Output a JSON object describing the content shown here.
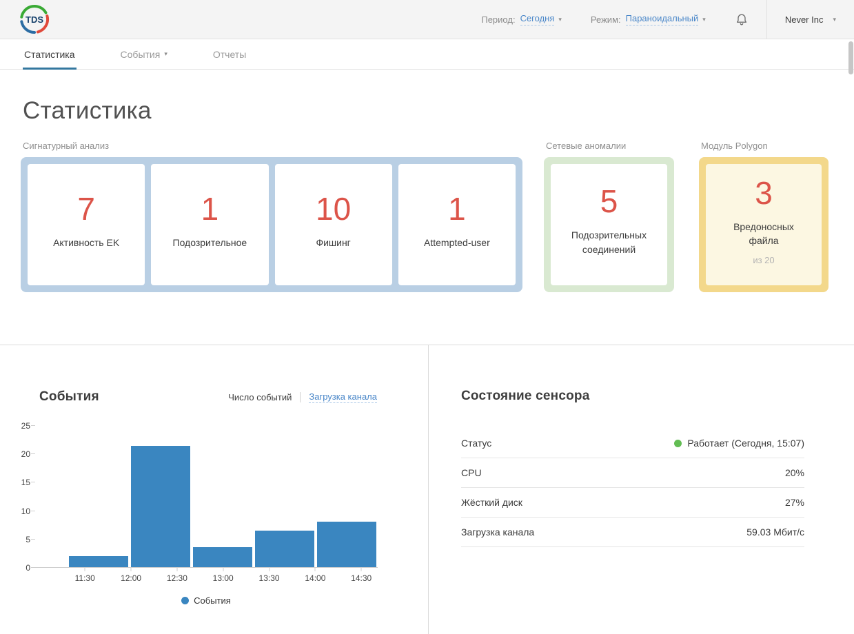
{
  "header": {
    "logo_text": "TDS",
    "period_label": "Период:",
    "period_value": "Сегодня",
    "mode_label": "Режим:",
    "mode_value": "Параноидальный",
    "account_name": "Never Inc"
  },
  "tabs": [
    {
      "label": "Статистика",
      "active": true
    },
    {
      "label": "События",
      "has_dropdown": true
    },
    {
      "label": "Отчеты",
      "active": false
    }
  ],
  "page": {
    "title": "Статистика"
  },
  "groups": {
    "signature": {
      "label": "Сигнатурный анализ",
      "accent": "#b9cfe4",
      "cards": [
        {
          "value": "7",
          "label": "Активность EK"
        },
        {
          "value": "1",
          "label": "Подозрительное"
        },
        {
          "value": "10",
          "label": "Фишинг"
        },
        {
          "value": "1",
          "label": "Attempted-user"
        }
      ]
    },
    "network": {
      "label": "Сетевые аномалии",
      "accent": "#d9e9d1",
      "card": {
        "value": "5",
        "label": "Подозрительных соединений"
      }
    },
    "polygon": {
      "label": "Модуль Polygon",
      "accent": "#f3d88b",
      "card_bg": "#fcf7e2",
      "card": {
        "value": "3",
        "label": "Вредоносных файла",
        "sub": "из 20"
      }
    }
  },
  "events": {
    "title": "События",
    "toggle": [
      "Число событий",
      "Загрузка канала"
    ],
    "legend": "События"
  },
  "chart_data": {
    "type": "bar",
    "title": "События",
    "xlabel": "",
    "ylabel": "",
    "ylim": [
      0,
      25
    ],
    "y_ticks": [
      0,
      5,
      10,
      15,
      20,
      25
    ],
    "x_tick_labels": [
      "11:30",
      "12:00",
      "12:30",
      "13:00",
      "13:30",
      "14:00",
      "14:30"
    ],
    "series": [
      {
        "name": "События",
        "values": [
          2,
          21.5,
          3.5,
          6.5,
          8
        ]
      }
    ],
    "legend_position": "bottom",
    "grid": false
  },
  "sensor": {
    "title": "Состояние сенсора",
    "rows": [
      {
        "label": "Статус",
        "value": "Работает (Сегодня, 15:07)",
        "status": "ok"
      },
      {
        "label": "CPU",
        "value": "20%"
      },
      {
        "label": "Жёсткий диск",
        "value": "27%"
      },
      {
        "label": "Загрузка канала",
        "value": "59.03 Мбит/с"
      }
    ]
  },
  "colors": {
    "accent_red": "#dc5449",
    "link_blue": "#4a87c9",
    "bar_blue": "#3a86c0",
    "tab_underline": "#34789f",
    "status_green": "#62bd53",
    "box_blue": "#b9cfe4",
    "box_green": "#d9e9d1",
    "box_yellow": "#f3d88b",
    "card_yellow": "#fcf7e2"
  }
}
